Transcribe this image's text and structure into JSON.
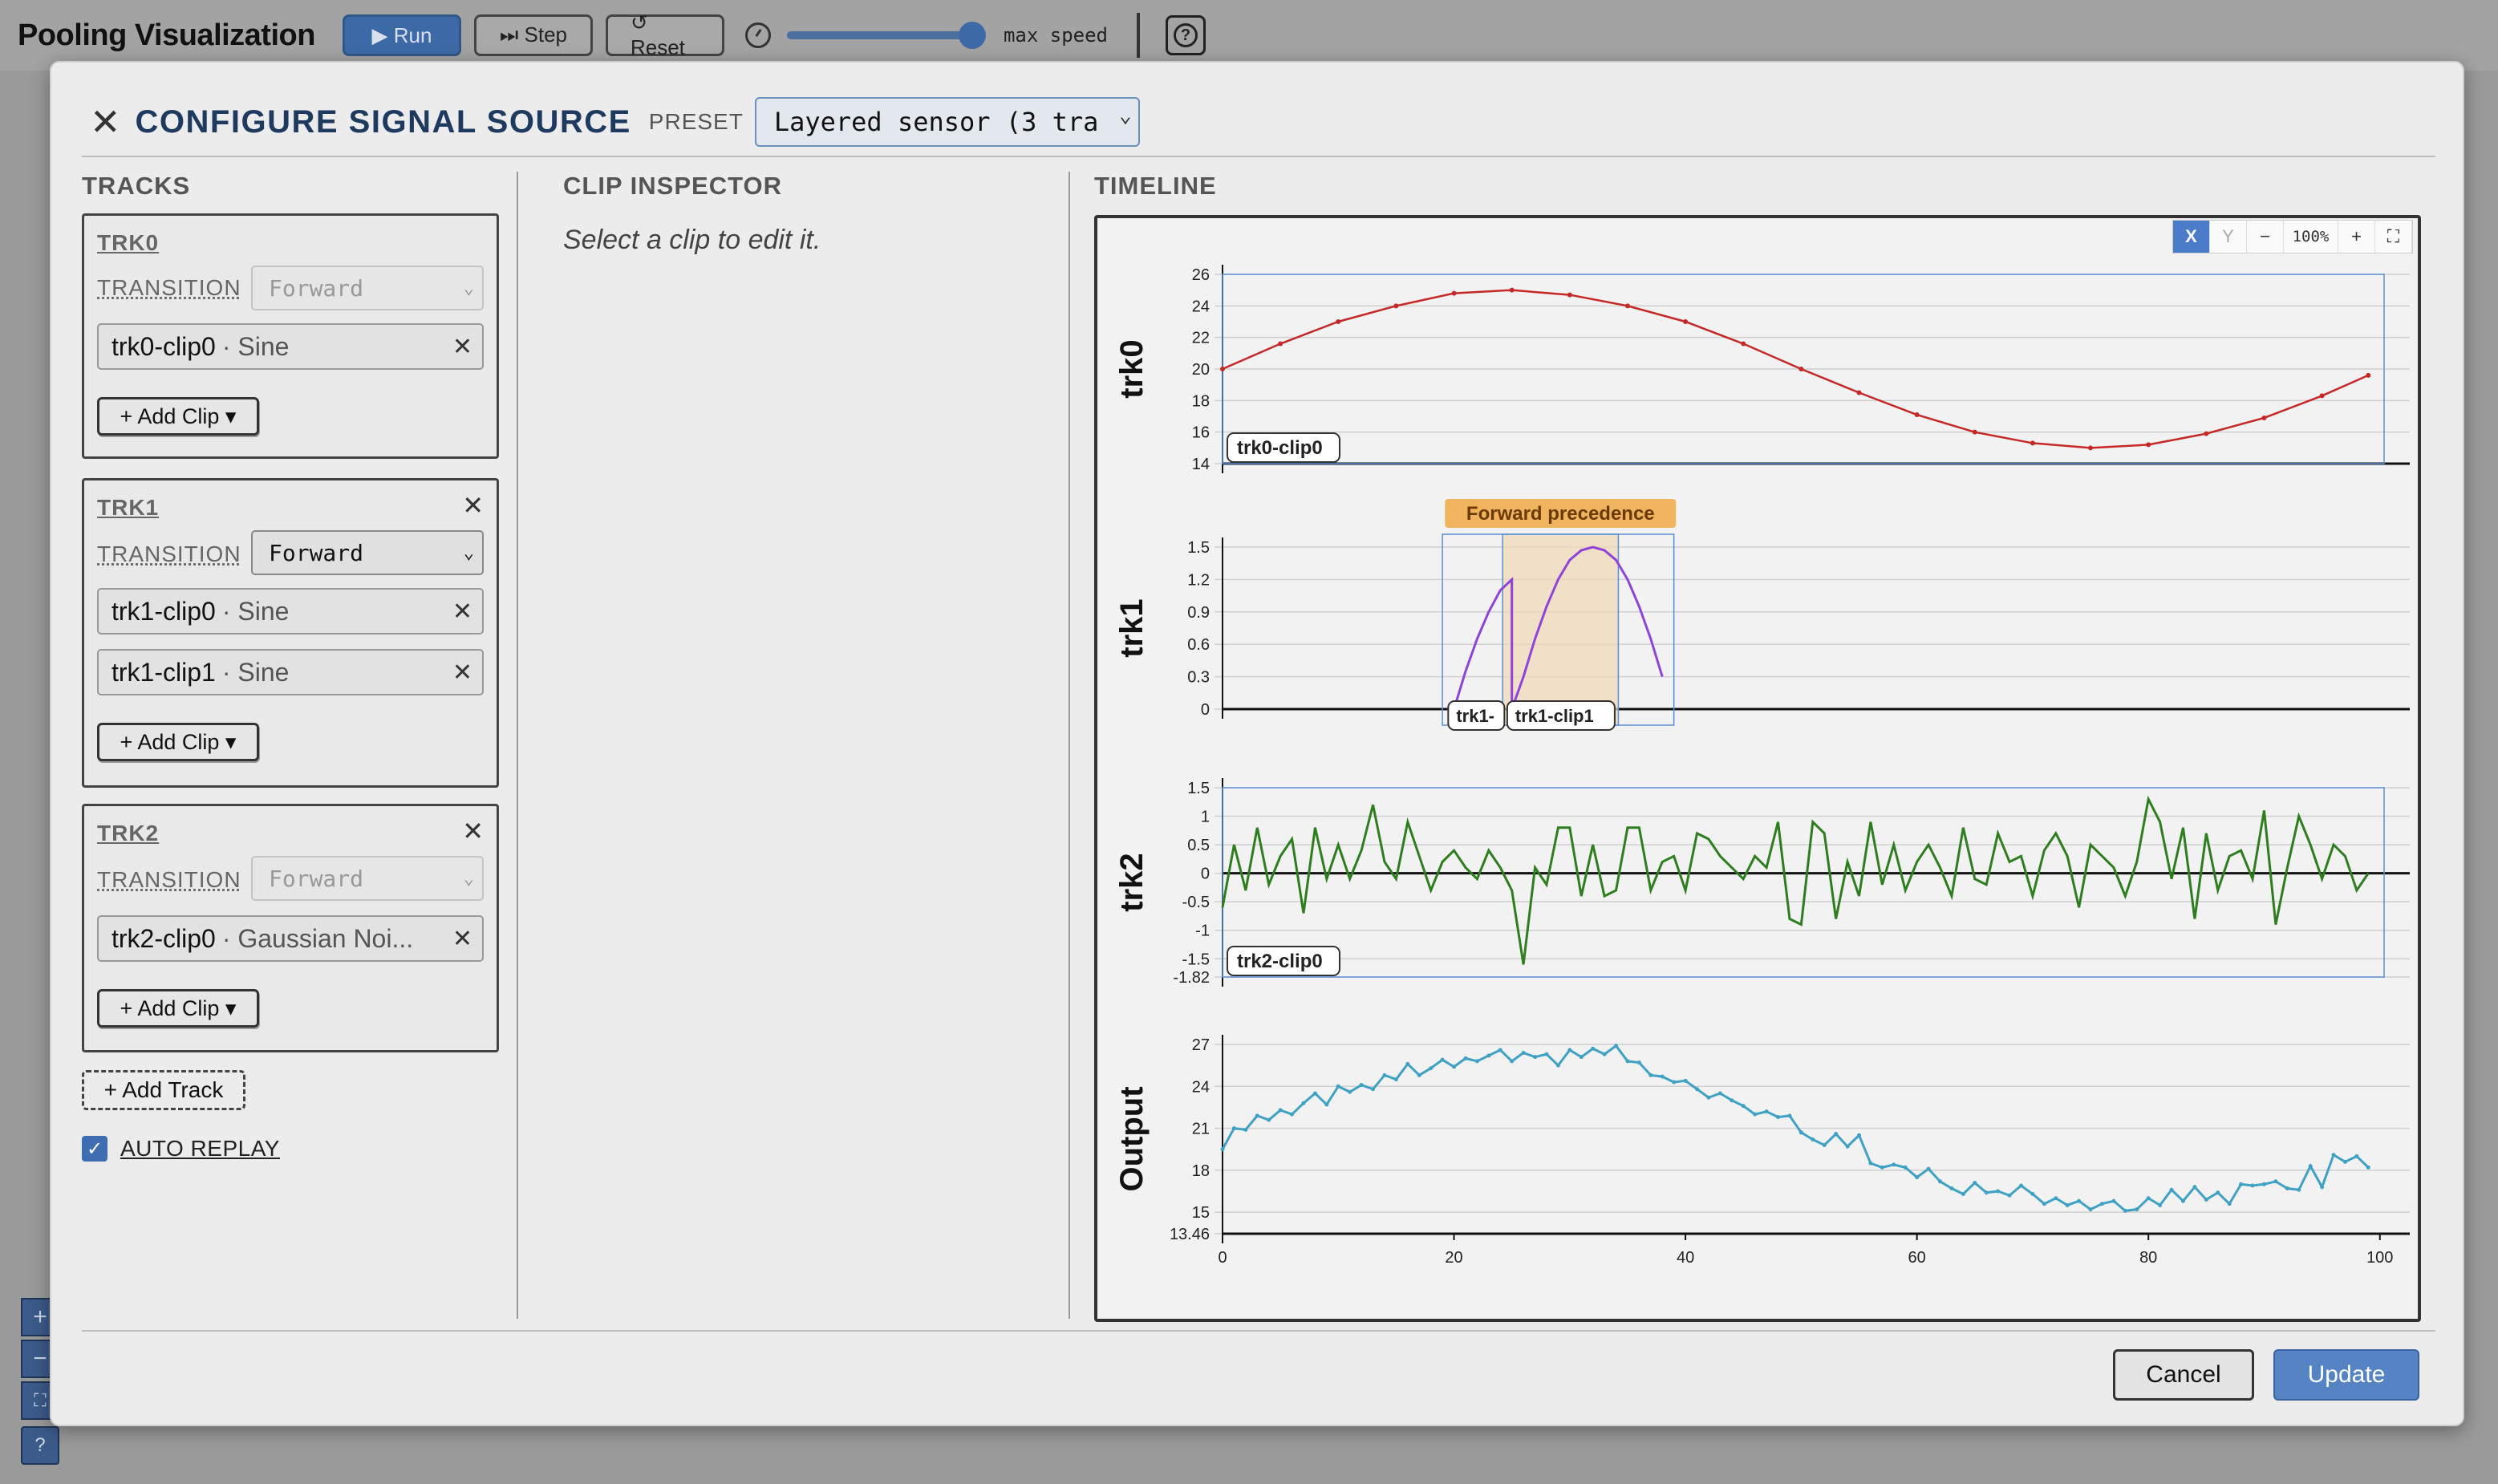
{
  "app": {
    "title": "Pooling Visualization",
    "run_label": "▶ Run",
    "step_label": "⏭ Step",
    "reset_label": "↺ Reset",
    "speed_label": "max speed",
    "speed_value": 1.0,
    "help_label": "?"
  },
  "modal": {
    "title": "CONFIGURE SIGNAL SOURCE",
    "close_icon": "close-icon",
    "preset_label": "PRESET",
    "preset_value": "Layered sensor (3 tra",
    "columns": {
      "tracks": "TRACKS",
      "inspector": "CLIP INSPECTOR",
      "timeline": "TIMELINE"
    },
    "inspector_hint": "Select a clip to edit it.",
    "add_track_label": "+ Add Track",
    "auto_replay_label": "AUTO REPLAY",
    "auto_replay_checked": true,
    "cancel_label": "Cancel",
    "update_label": "Update"
  },
  "tracks": [
    {
      "name": "TRK0",
      "transition_label": "TRANSITION",
      "transition": "Forward",
      "transition_enabled": false,
      "removable": false,
      "clips": [
        {
          "name": "trk0-clip0",
          "type": "· Sine"
        }
      ],
      "add_clip_label": "+ Add Clip ▾"
    },
    {
      "name": "TRK1",
      "transition_label": "TRANSITION",
      "transition": "Forward",
      "transition_enabled": true,
      "removable": true,
      "clips": [
        {
          "name": "trk1-clip0",
          "type": "· Sine"
        },
        {
          "name": "trk1-clip1",
          "type": "· Sine"
        }
      ],
      "add_clip_label": "+ Add Clip ▾"
    },
    {
      "name": "TRK2",
      "transition_label": "TRANSITION",
      "transition": "Forward",
      "transition_enabled": false,
      "removable": true,
      "clips": [
        {
          "name": "trk2-clip0",
          "type": "· Gaussian Noi..."
        }
      ],
      "add_clip_label": "+ Add Clip ▾"
    }
  ],
  "timeline_toolbar": {
    "x": "X",
    "y": "Y",
    "zoom_out": "−",
    "zoom": "100%",
    "zoom_in": "+",
    "fit_icon": "fit-screen-icon"
  },
  "chart_data": [
    {
      "type": "line",
      "ylabel": "trk0",
      "ylim": [
        14,
        26
      ],
      "xlim": [
        0,
        100
      ],
      "yticks": [
        14,
        16,
        18,
        20,
        22,
        24,
        26
      ],
      "series_color": "#c62828",
      "clip_labels": [
        "trk0-clip0"
      ],
      "x": [
        0,
        5,
        10,
        15,
        20,
        25,
        30,
        35,
        40,
        45,
        50,
        55,
        60,
        65,
        70,
        75,
        80,
        85,
        90,
        95,
        99
      ],
      "y": [
        20,
        21.6,
        23,
        24,
        24.8,
        25,
        24.7,
        24,
        23,
        21.6,
        20,
        18.5,
        17.1,
        16,
        15.3,
        15,
        15.2,
        15.9,
        16.9,
        18.3,
        19.6
      ]
    },
    {
      "type": "line",
      "ylabel": "trk1",
      "ylim": [
        0,
        1.5
      ],
      "xlim": [
        0,
        100
      ],
      "yticks": [
        0,
        0.3,
        0.6,
        0.9,
        1.2,
        1.5
      ],
      "series_color": "#8e44d8",
      "annotation": "Forward precedence",
      "clip_labels": [
        "trk1-",
        "trk1-clip1"
      ],
      "x": [
        20,
        21,
        22,
        23,
        24,
        25,
        25,
        26,
        27,
        28,
        29,
        30,
        31,
        32,
        33,
        34,
        35,
        36,
        37,
        38
      ],
      "y": [
        0,
        0.35,
        0.65,
        0.9,
        1.1,
        1.2,
        0,
        0.3,
        0.65,
        0.95,
        1.2,
        1.38,
        1.47,
        1.5,
        1.47,
        1.38,
        1.2,
        0.95,
        0.65,
        0.3
      ]
    },
    {
      "type": "line",
      "ylabel": "trk2",
      "ylim": [
        -1.82,
        1.5
      ],
      "xlim": [
        0,
        100
      ],
      "yticks": [
        -1.82,
        -1.5,
        -1,
        -0.5,
        0,
        0.5,
        1,
        1.5
      ],
      "series_color": "#2e7d1e",
      "clip_labels": [
        "trk2-clip0"
      ],
      "x": [
        0,
        1,
        2,
        3,
        4,
        5,
        6,
        7,
        8,
        9,
        10,
        11,
        12,
        13,
        14,
        15,
        16,
        17,
        18,
        19,
        20,
        21,
        22,
        23,
        24,
        25,
        26,
        27,
        28,
        29,
        30,
        31,
        32,
        33,
        34,
        35,
        36,
        37,
        38,
        39,
        40,
        41,
        42,
        43,
        44,
        45,
        46,
        47,
        48,
        49,
        50,
        51,
        52,
        53,
        54,
        55,
        56,
        57,
        58,
        59,
        60,
        61,
        62,
        63,
        64,
        65,
        66,
        67,
        68,
        69,
        70,
        71,
        72,
        73,
        74,
        75,
        76,
        77,
        78,
        79,
        80,
        81,
        82,
        83,
        84,
        85,
        86,
        87,
        88,
        89,
        90,
        91,
        92,
        93,
        94,
        95,
        96,
        97,
        98,
        99
      ],
      "y": [
        -0.6,
        0.5,
        -0.3,
        0.8,
        -0.2,
        0.3,
        0.6,
        -0.7,
        0.8,
        -0.1,
        0.5,
        -0.1,
        0.4,
        1.2,
        0.2,
        -0.1,
        0.9,
        0.3,
        -0.3,
        0.2,
        0.4,
        0.1,
        -0.1,
        0.4,
        0.1,
        -0.3,
        -1.6,
        0.1,
        -0.2,
        0.8,
        0.8,
        -0.4,
        0.5,
        -0.4,
        -0.3,
        0.8,
        0.8,
        -0.3,
        0.2,
        0.3,
        -0.3,
        0.7,
        0.6,
        0.3,
        0.1,
        -0.1,
        0.3,
        0.1,
        0.9,
        -0.8,
        -0.9,
        0.9,
        0.7,
        -0.8,
        0.2,
        -0.4,
        0.9,
        -0.2,
        0.5,
        -0.3,
        0.2,
        0.5,
        0.1,
        -0.4,
        0.8,
        -0.1,
        -0.2,
        0.7,
        0.2,
        0.3,
        -0.4,
        0.4,
        0.7,
        0.3,
        -0.6,
        0.5,
        0.3,
        0.1,
        -0.4,
        0.2,
        1.3,
        0.9,
        -0.1,
        0.8,
        -0.8,
        0.7,
        -0.3,
        0.3,
        0.4,
        -0.1,
        1.1,
        -0.9,
        0.1,
        1,
        0.5,
        -0.1,
        0.5,
        0.3,
        -0.3,
        0
      ]
    },
    {
      "type": "line",
      "ylabel": "Output",
      "ylim": [
        13.46,
        27
      ],
      "xlim": [
        0,
        100
      ],
      "yticks": [
        13.46,
        15,
        18,
        21,
        24,
        27
      ],
      "xticks": [
        0,
        20,
        40,
        60,
        80,
        100
      ],
      "series_color": "#3fa1c4",
      "x": [
        0,
        1,
        2,
        3,
        4,
        5,
        6,
        7,
        8,
        9,
        10,
        11,
        12,
        13,
        14,
        15,
        16,
        17,
        18,
        19,
        20,
        21,
        22,
        23,
        24,
        25,
        26,
        27,
        28,
        29,
        30,
        31,
        32,
        33,
        34,
        35,
        36,
        37,
        38,
        39,
        40,
        41,
        42,
        43,
        44,
        45,
        46,
        47,
        48,
        49,
        50,
        51,
        52,
        53,
        54,
        55,
        56,
        57,
        58,
        59,
        60,
        61,
        62,
        63,
        64,
        65,
        66,
        67,
        68,
        69,
        70,
        71,
        72,
        73,
        74,
        75,
        76,
        77,
        78,
        79,
        80,
        81,
        82,
        83,
        84,
        85,
        86,
        87,
        88,
        89,
        90,
        91,
        92,
        93,
        94,
        95,
        96,
        97,
        98,
        99
      ],
      "y": [
        19.5,
        21,
        20.9,
        21.9,
        21.6,
        22.3,
        22,
        22.8,
        23.5,
        22.7,
        24,
        23.6,
        24.1,
        23.8,
        24.8,
        24.5,
        25.6,
        24.8,
        25.3,
        25.9,
        25.4,
        26,
        25.8,
        26.2,
        26.6,
        25.8,
        26.4,
        26.1,
        26.3,
        25.5,
        26.6,
        26.1,
        26.7,
        26.3,
        26.9,
        25.8,
        25.7,
        24.8,
        24.7,
        24.3,
        24.4,
        23.8,
        23.2,
        23.5,
        23,
        22.6,
        22,
        22.2,
        21.8,
        21.9,
        20.7,
        20.2,
        19.8,
        20.6,
        19.7,
        20.5,
        18.5,
        18.2,
        18.4,
        18.2,
        17.5,
        18.1,
        17.2,
        16.7,
        16.3,
        17.1,
        16.4,
        16.5,
        16.2,
        16.9,
        16.3,
        15.6,
        16,
        15.5,
        15.8,
        15.2,
        15.6,
        15.8,
        15.1,
        15.2,
        16,
        15.5,
        16.6,
        15.8,
        16.8,
        15.9,
        16.4,
        15.6,
        17,
        16.9,
        17,
        17.2,
        16.7,
        16.6,
        18.3,
        16.8,
        19.1,
        18.6,
        19,
        18.2
      ]
    }
  ]
}
